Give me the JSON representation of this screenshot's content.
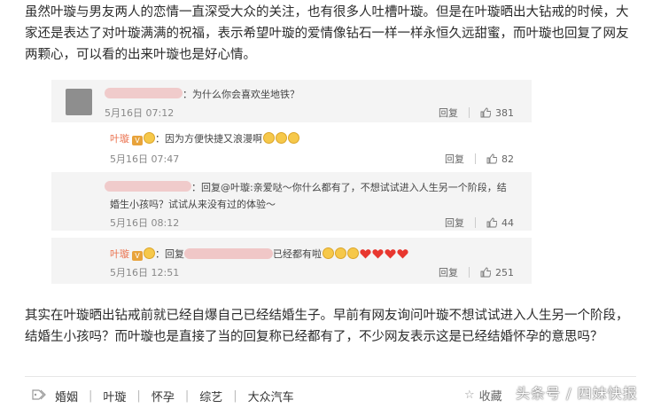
{
  "article": {
    "para1": "虽然叶璇与男友两人的恋情一直深受大众的关注，也有很多人吐槽叶璇。但是在叶璇晒出大钻戒的时候，大家还是表达了对叶璇满满的祝福，表示希望叶璇的爱情像钻石一样一样永恒久远甜蜜，而叶璇也回复了网友两颗心，可以看的出来叶璇也是好心情。",
    "para2": "其实在叶璇晒出钻戒前就已经自爆自己已经结婚生子。早前有网友询问叶璇不想试试进入人生另一个阶段，结婚生小孩吗？而叶璇也是直接了当的回复称已经都有了，不少网友表示这是已经结婚怀孕的意思吗？"
  },
  "comments": [
    {
      "text": "：为什么你会喜欢坐地铁？",
      "time": "5月16日 07:12",
      "reply_label": "回复",
      "likes": "381"
    },
    {
      "user": "叶璇",
      "text": "：因为方便快捷又浪漫啊",
      "time": "5月16日 07:47",
      "reply_label": "回复",
      "likes": "82"
    },
    {
      "text_line1": "：回复@叶璇:亲爱哒～你什么都有了，不想试试进入人生另一个阶段，结",
      "text_line2": "婚生小孩吗？试试从来没有过的体验～",
      "time": "5月16日 08:12",
      "reply_label": "回复",
      "likes": "44"
    },
    {
      "user": "叶璇",
      "text_prefix": "：回复",
      "text_suffix": "已经都有啦",
      "time": "5月16日 12:51",
      "reply_label": "回复",
      "likes": "251"
    }
  ],
  "footer": {
    "tags": [
      "婚姻",
      "叶璇",
      "怀孕",
      "综艺",
      "大众汽车"
    ],
    "collect_label": "收藏",
    "watermark": "头条号 / 四妹快报"
  },
  "icons": {
    "tag": "tag-icon",
    "like": "thumbs-up-icon",
    "collect": "star-icon",
    "verified": "verified-badge-icon",
    "emoji": "smiley-emoji-icon",
    "heart": "heart-emoji-icon"
  },
  "colors": {
    "username": "#eb7350",
    "heart": "#e8372f",
    "emoji": "#f6c84a"
  }
}
